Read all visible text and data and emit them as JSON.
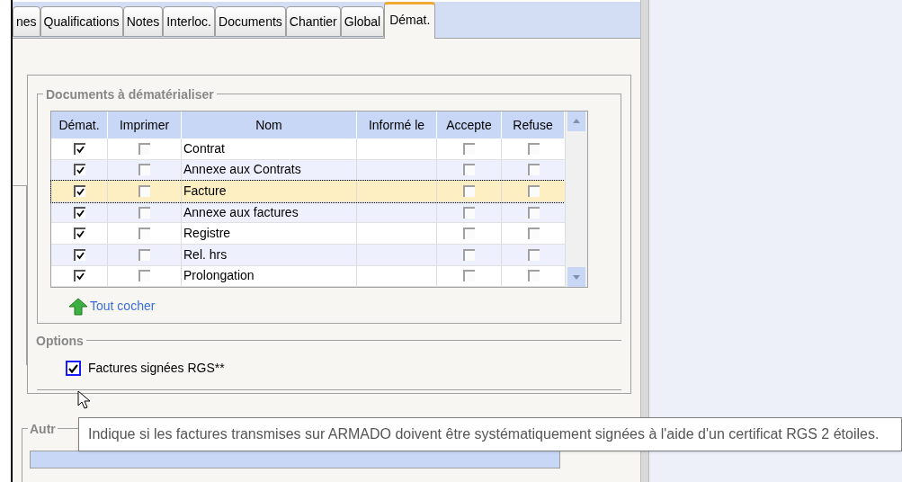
{
  "tabs": [
    {
      "label": "nes",
      "selected": false
    },
    {
      "label": "Qualifications",
      "selected": false
    },
    {
      "label": "Notes",
      "selected": false
    },
    {
      "label": "Interloc.",
      "selected": false
    },
    {
      "label": "Documents",
      "selected": false
    },
    {
      "label": "Chantier",
      "selected": false
    },
    {
      "label": "Global",
      "selected": false
    },
    {
      "label": "Démat.",
      "selected": true
    }
  ],
  "documents_group": {
    "title": "Documents à dématérialiser",
    "table": {
      "columns": [
        "Démat.",
        "Imprimer",
        "Nom",
        "Informé le",
        "Accepte",
        "Refuse"
      ],
      "rows": [
        {
          "demat": true,
          "imprimer": false,
          "nom": "Contrat",
          "accepte": false,
          "refuse": false,
          "selected": false
        },
        {
          "demat": true,
          "imprimer": false,
          "nom": "Annexe aux Contrats",
          "accepte": false,
          "refuse": false,
          "selected": false
        },
        {
          "demat": true,
          "imprimer": false,
          "nom": "Facture",
          "accepte": false,
          "refuse": false,
          "selected": true
        },
        {
          "demat": true,
          "imprimer": false,
          "nom": "Annexe aux factures",
          "accepte": false,
          "refuse": false,
          "selected": false
        },
        {
          "demat": true,
          "imprimer": false,
          "nom": "Registre",
          "accepte": false,
          "refuse": false,
          "selected": false
        },
        {
          "demat": true,
          "imprimer": false,
          "nom": "Rel. hrs",
          "accepte": false,
          "refuse": false,
          "selected": false
        },
        {
          "demat": true,
          "imprimer": false,
          "nom": "Prolongation",
          "accepte": false,
          "refuse": false,
          "selected": false
        }
      ]
    },
    "check_all_link": "Tout cocher"
  },
  "options_group": {
    "title": "Options",
    "checkbox": {
      "label": "Factures signées RGS**",
      "checked": true
    }
  },
  "other_group": {
    "title": "Autr"
  },
  "tooltip": "Indique si les factures transmises sur ARMADO doivent être systématiquement signées à l'aide d'un certificat RGS 2 étoiles."
}
